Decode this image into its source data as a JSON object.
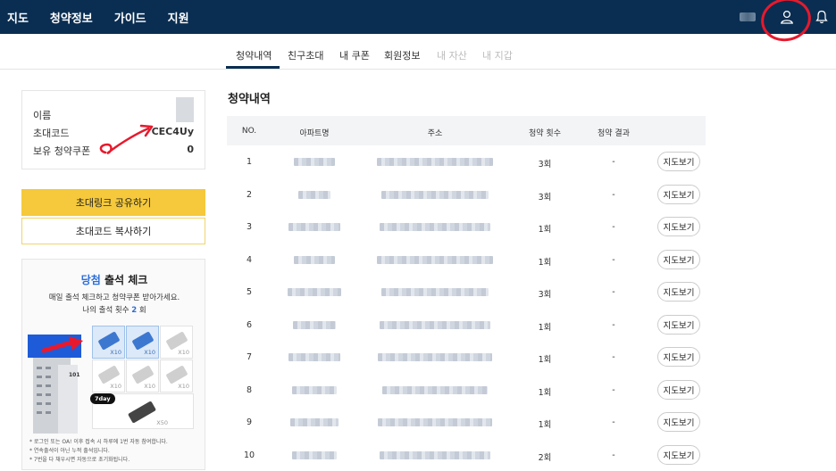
{
  "topnav": {
    "items": [
      "지도",
      "청약정보",
      "가이드",
      "지원"
    ]
  },
  "header": {
    "user_icon": "user-icon",
    "bell_icon": "bell-icon"
  },
  "tabs": [
    {
      "label": "청약내역",
      "active": true,
      "disabled": false
    },
    {
      "label": "친구초대",
      "active": false,
      "disabled": false
    },
    {
      "label": "내 쿠폰",
      "active": false,
      "disabled": false
    },
    {
      "label": "회원정보",
      "active": false,
      "disabled": false
    },
    {
      "label": "내 자산",
      "active": false,
      "disabled": true
    },
    {
      "label": "내 지갑",
      "active": false,
      "disabled": true
    }
  ],
  "profile": {
    "name_label": "이름",
    "code_label": "초대코드",
    "code_value": "CEC4Uy",
    "coupon_label": "보유 청약쿠폰",
    "coupon_value": "0"
  },
  "buttons": {
    "share": "초대링크 공유하기",
    "copy": "초대코드 복사하기"
  },
  "attendance": {
    "title_hl": "당첨",
    "title_rest": " 출석 체크",
    "subtitle": "매일 출석 체크하고 청약쿠폰 받아가세요.",
    "count_prefix": "나의 출석 횟수 ",
    "count_value": "2",
    "count_suffix": " 회",
    "badge": "7day",
    "building_number": "101",
    "multipliers": [
      "X10",
      "X10",
      "X10",
      "X10",
      "X10",
      "X10"
    ],
    "big_multiplier": "X50",
    "checked_cells": 2,
    "notes": [
      "* 로그인 또는 OA! 이후 접속 시 하루에 1번 자동 참여합니다.",
      "* 연속출석이 아닌 누적 출석입니다.",
      "* 7번을 다 채우시면 자동으로 초기화됩니다."
    ]
  },
  "section_title": "청약내역",
  "table": {
    "headers": [
      "NO.",
      "아파트명",
      "주소",
      "청약 횟수",
      "청약 결과"
    ],
    "map_button_label": "지도보기",
    "rows": [
      {
        "no": "1",
        "count": "3회",
        "result": "-"
      },
      {
        "no": "2",
        "count": "3회",
        "result": "-"
      },
      {
        "no": "3",
        "count": "1회",
        "result": "-"
      },
      {
        "no": "4",
        "count": "1회",
        "result": "-"
      },
      {
        "no": "5",
        "count": "3회",
        "result": "-"
      },
      {
        "no": "6",
        "count": "1회",
        "result": "-"
      },
      {
        "no": "7",
        "count": "1회",
        "result": "-"
      },
      {
        "no": "8",
        "count": "1회",
        "result": "-"
      },
      {
        "no": "9",
        "count": "1회",
        "result": "-"
      },
      {
        "no": "10",
        "count": "2회",
        "result": "-"
      }
    ]
  }
}
